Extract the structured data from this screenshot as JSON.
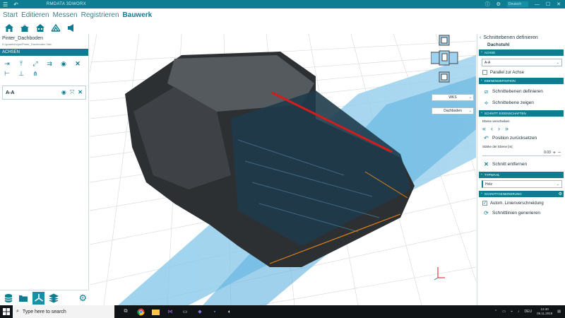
{
  "app": {
    "title": "RMDATA 3DWORX",
    "search_placeholder": "Deutsch"
  },
  "menu": {
    "items": [
      "Start",
      "Editieren",
      "Messen",
      "Registrieren",
      "Bauwerk"
    ],
    "active": "Bauwerk"
  },
  "ribbon": {
    "icons": [
      "house-icon",
      "house-roof-icon",
      "house-section-icon",
      "roof-truss-icon",
      "speaker-icon"
    ]
  },
  "left": {
    "project_name": "Pinter_Dachboden",
    "project_path": "D:\\gradela\\vgm\\Pinter_Dachboden.3dw",
    "section_label": "ACHSEN",
    "axis_item": "A-A"
  },
  "viewport": {
    "dropdown1": "WKS",
    "dropdown2": "Dachboden"
  },
  "right": {
    "back_title": "Schnittebenen definieren",
    "subtitle": "Dachstuhl",
    "sec_achse": "ACHSE",
    "axis_value": "A-A",
    "parallel_label": "Parallel zur Achse",
    "sec_ebenendef": "EBENENDEFINITION",
    "define_label": "Schnittebenen definieren",
    "show_label": "Schnittebene zeigen",
    "sec_schnitt": "SCHNITT EIGENSCHAFTEN",
    "move_label": "Ebene verschieben",
    "reset_label": "Position zurücksetzen",
    "thickness_label": "Stärke der Ebene [m]",
    "thickness_value": "0.03",
    "remove_label": "Schnitt entfernen",
    "sec_typ": "TYPWAHL",
    "type_value": "Holz",
    "sec_gen": "SCHNITTGENERIERUNG",
    "auto_label": "Autom. Linienverschneidung",
    "generate_label": "Schnittlinien generieren"
  },
  "taskbar": {
    "search": "Type here to search",
    "lang": "DEU",
    "time": "12:40",
    "date": "06.11.2019"
  }
}
